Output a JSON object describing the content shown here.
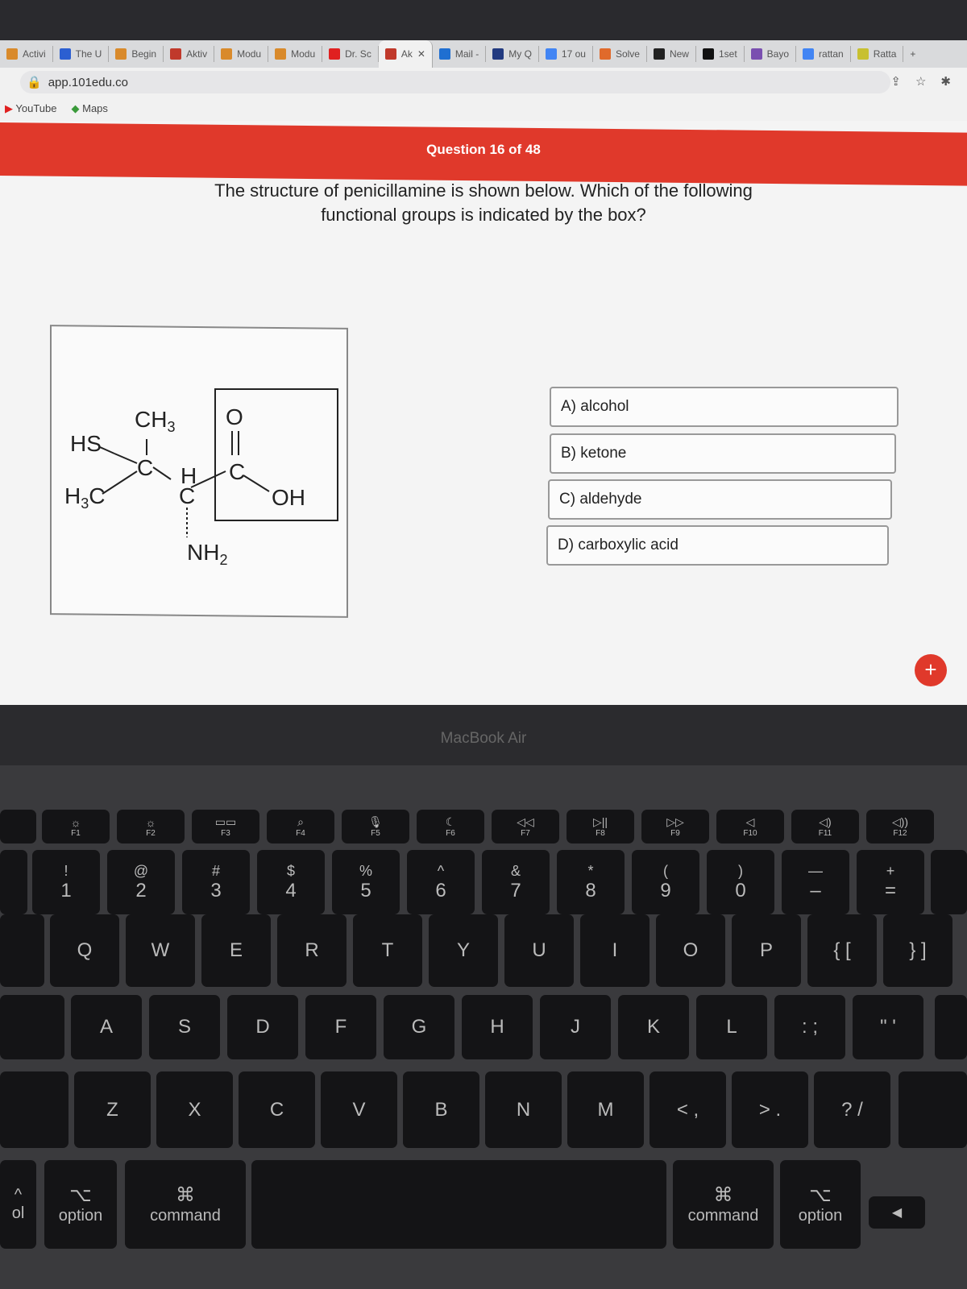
{
  "browser": {
    "tabs": [
      {
        "label": "Activi",
        "color": "#d98a2b"
      },
      {
        "label": "The U",
        "color": "#2c5fd1"
      },
      {
        "label": "Begin",
        "color": "#d98a2b"
      },
      {
        "label": "Aktiv",
        "color": "#c0392b"
      },
      {
        "label": "Modu",
        "color": "#d98a2b"
      },
      {
        "label": "Modu",
        "color": "#d98a2b"
      },
      {
        "label": "Dr. Sc",
        "color": "#e02020"
      },
      {
        "label": "Ak",
        "color": "#c0392b",
        "active": true
      },
      {
        "label": "Mail -",
        "color": "#1f6fd1"
      },
      {
        "label": "My Q",
        "color": "#223a80"
      },
      {
        "label": "17 ou",
        "color": "#4285f4"
      },
      {
        "label": "Solve",
        "color": "#e06a2b"
      },
      {
        "label": "New",
        "color": "#222"
      },
      {
        "label": "1set",
        "color": "#111"
      },
      {
        "label": "Bayo",
        "color": "#7a4fb0"
      },
      {
        "label": "rattan",
        "color": "#4285f4"
      },
      {
        "label": "Ratta",
        "color": "#c8c030"
      }
    ],
    "close_tab": "✕",
    "new_tab": "+",
    "url": "app.101edu.co",
    "bookmarks": [
      {
        "label": "YouTube"
      },
      {
        "label": "Maps"
      }
    ]
  },
  "quiz": {
    "header": "Question 16 of 48",
    "question": "The structure of penicillamine is shown below. Which of the following functional groups is indicated by the box?",
    "molecule": {
      "hs": "HS",
      "h3c": [
        "H",
        "3",
        "C"
      ],
      "ch3": [
        "CH",
        "3"
      ],
      "c1": "C",
      "h": "H",
      "c2": "C",
      "c3": "C",
      "o": "O",
      "oh": "OH",
      "nh2": [
        "NH",
        "2"
      ]
    },
    "options": [
      "A) alcohol",
      "B) ketone",
      "C) aldehyde",
      "D) carboxylic acid"
    ],
    "add": "+"
  },
  "device": {
    "brand": "MacBook Air"
  },
  "keyboard": {
    "fn": [
      "F1",
      "F2",
      "F3",
      "F4",
      "F5",
      "F6",
      "F7",
      "F8",
      "F9",
      "F10",
      "F11",
      "F12"
    ],
    "fn_icons": [
      "☼",
      "☼",
      "▭▭",
      "⌕",
      "🎙",
      "☾",
      "◁◁",
      "▷||",
      "▷▷",
      "◁",
      "◁)",
      "◁))"
    ],
    "numbers": [
      [
        "!",
        "1"
      ],
      [
        "@",
        "2"
      ],
      [
        "#",
        "3"
      ],
      [
        "$",
        "4"
      ],
      [
        "%",
        "5"
      ],
      [
        "^",
        "6"
      ],
      [
        "&",
        "7"
      ],
      [
        "*",
        "8"
      ],
      [
        "(",
        "9"
      ],
      [
        ")",
        "0"
      ],
      [
        "—",
        "–"
      ],
      [
        "+",
        "="
      ]
    ],
    "row_q": [
      "Q",
      "W",
      "E",
      "R",
      "T",
      "Y",
      "U",
      "I",
      "O",
      "P",
      "{ [",
      "} ]"
    ],
    "row_a": [
      "A",
      "S",
      "D",
      "F",
      "G",
      "H",
      "J",
      "K",
      "L",
      ": ;",
      "\" '"
    ],
    "row_z": [
      "Z",
      "X",
      "C",
      "V",
      "B",
      "N",
      "M",
      "< ,",
      "> .",
      "? /"
    ],
    "bottom": {
      "control": "ol",
      "option_l": "option",
      "option_sym": "⌥",
      "command_l": "command",
      "command_sym": "⌘",
      "command_r": "command",
      "option_r": "option",
      "arrow": "◀",
      "up": "^"
    }
  }
}
